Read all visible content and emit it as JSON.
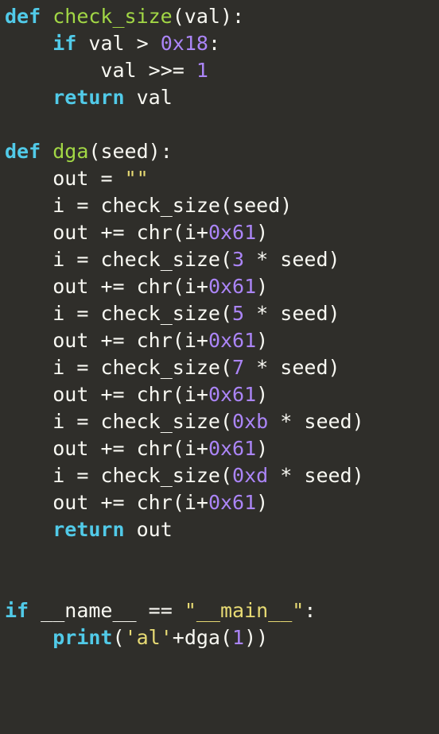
{
  "code": {
    "lines": [
      {
        "indent": 0,
        "tokens": [
          {
            "cls": "kw",
            "t": "def"
          },
          {
            "cls": "op",
            "t": " "
          },
          {
            "cls": "fn",
            "t": "check_size"
          },
          {
            "cls": "op",
            "t": "("
          },
          {
            "cls": "id",
            "t": "val"
          },
          {
            "cls": "op",
            "t": "):"
          }
        ]
      },
      {
        "indent": 1,
        "tokens": [
          {
            "cls": "kw",
            "t": "if"
          },
          {
            "cls": "op",
            "t": " "
          },
          {
            "cls": "id",
            "t": "val"
          },
          {
            "cls": "op",
            "t": " "
          },
          {
            "cls": "op",
            "t": ">"
          },
          {
            "cls": "op",
            "t": " "
          },
          {
            "cls": "num",
            "t": "0x18"
          },
          {
            "cls": "op",
            "t": ":"
          }
        ]
      },
      {
        "indent": 2,
        "tokens": [
          {
            "cls": "id",
            "t": "val"
          },
          {
            "cls": "op",
            "t": " "
          },
          {
            "cls": "op",
            "t": ">>="
          },
          {
            "cls": "op",
            "t": " "
          },
          {
            "cls": "num",
            "t": "1"
          }
        ]
      },
      {
        "indent": 1,
        "tokens": [
          {
            "cls": "kw",
            "t": "return"
          },
          {
            "cls": "op",
            "t": " "
          },
          {
            "cls": "id",
            "t": "val"
          }
        ]
      },
      {
        "indent": 0,
        "tokens": []
      },
      {
        "indent": 0,
        "tokens": [
          {
            "cls": "kw",
            "t": "def"
          },
          {
            "cls": "op",
            "t": " "
          },
          {
            "cls": "fn",
            "t": "dga"
          },
          {
            "cls": "op",
            "t": "("
          },
          {
            "cls": "id",
            "t": "seed"
          },
          {
            "cls": "op",
            "t": "):"
          }
        ]
      },
      {
        "indent": 1,
        "tokens": [
          {
            "cls": "id",
            "t": "out"
          },
          {
            "cls": "op",
            "t": " "
          },
          {
            "cls": "op",
            "t": "="
          },
          {
            "cls": "op",
            "t": " "
          },
          {
            "cls": "str",
            "t": "\"\""
          }
        ]
      },
      {
        "indent": 1,
        "tokens": [
          {
            "cls": "id",
            "t": "i"
          },
          {
            "cls": "op",
            "t": " "
          },
          {
            "cls": "op",
            "t": "="
          },
          {
            "cls": "op",
            "t": " "
          },
          {
            "cls": "id",
            "t": "check_size"
          },
          {
            "cls": "op",
            "t": "("
          },
          {
            "cls": "id",
            "t": "seed"
          },
          {
            "cls": "op",
            "t": ")"
          }
        ]
      },
      {
        "indent": 1,
        "tokens": [
          {
            "cls": "id",
            "t": "out"
          },
          {
            "cls": "op",
            "t": " "
          },
          {
            "cls": "op",
            "t": "+="
          },
          {
            "cls": "op",
            "t": " "
          },
          {
            "cls": "id",
            "t": "chr"
          },
          {
            "cls": "op",
            "t": "("
          },
          {
            "cls": "id",
            "t": "i"
          },
          {
            "cls": "op",
            "t": "+"
          },
          {
            "cls": "num",
            "t": "0x61"
          },
          {
            "cls": "op",
            "t": ")"
          }
        ]
      },
      {
        "indent": 1,
        "tokens": [
          {
            "cls": "id",
            "t": "i"
          },
          {
            "cls": "op",
            "t": " "
          },
          {
            "cls": "op",
            "t": "="
          },
          {
            "cls": "op",
            "t": " "
          },
          {
            "cls": "id",
            "t": "check_size"
          },
          {
            "cls": "op",
            "t": "("
          },
          {
            "cls": "num",
            "t": "3"
          },
          {
            "cls": "op",
            "t": " "
          },
          {
            "cls": "op",
            "t": "*"
          },
          {
            "cls": "op",
            "t": " "
          },
          {
            "cls": "id",
            "t": "seed"
          },
          {
            "cls": "op",
            "t": ")"
          }
        ]
      },
      {
        "indent": 1,
        "tokens": [
          {
            "cls": "id",
            "t": "out"
          },
          {
            "cls": "op",
            "t": " "
          },
          {
            "cls": "op",
            "t": "+="
          },
          {
            "cls": "op",
            "t": " "
          },
          {
            "cls": "id",
            "t": "chr"
          },
          {
            "cls": "op",
            "t": "("
          },
          {
            "cls": "id",
            "t": "i"
          },
          {
            "cls": "op",
            "t": "+"
          },
          {
            "cls": "num",
            "t": "0x61"
          },
          {
            "cls": "op",
            "t": ")"
          }
        ]
      },
      {
        "indent": 1,
        "tokens": [
          {
            "cls": "id",
            "t": "i"
          },
          {
            "cls": "op",
            "t": " "
          },
          {
            "cls": "op",
            "t": "="
          },
          {
            "cls": "op",
            "t": " "
          },
          {
            "cls": "id",
            "t": "check_size"
          },
          {
            "cls": "op",
            "t": "("
          },
          {
            "cls": "num",
            "t": "5"
          },
          {
            "cls": "op",
            "t": " "
          },
          {
            "cls": "op",
            "t": "*"
          },
          {
            "cls": "op",
            "t": " "
          },
          {
            "cls": "id",
            "t": "seed"
          },
          {
            "cls": "op",
            "t": ")"
          }
        ]
      },
      {
        "indent": 1,
        "tokens": [
          {
            "cls": "id",
            "t": "out"
          },
          {
            "cls": "op",
            "t": " "
          },
          {
            "cls": "op",
            "t": "+="
          },
          {
            "cls": "op",
            "t": " "
          },
          {
            "cls": "id",
            "t": "chr"
          },
          {
            "cls": "op",
            "t": "("
          },
          {
            "cls": "id",
            "t": "i"
          },
          {
            "cls": "op",
            "t": "+"
          },
          {
            "cls": "num",
            "t": "0x61"
          },
          {
            "cls": "op",
            "t": ")"
          }
        ]
      },
      {
        "indent": 1,
        "tokens": [
          {
            "cls": "id",
            "t": "i"
          },
          {
            "cls": "op",
            "t": " "
          },
          {
            "cls": "op",
            "t": "="
          },
          {
            "cls": "op",
            "t": " "
          },
          {
            "cls": "id",
            "t": "check_size"
          },
          {
            "cls": "op",
            "t": "("
          },
          {
            "cls": "num",
            "t": "7"
          },
          {
            "cls": "op",
            "t": " "
          },
          {
            "cls": "op",
            "t": "*"
          },
          {
            "cls": "op",
            "t": " "
          },
          {
            "cls": "id",
            "t": "seed"
          },
          {
            "cls": "op",
            "t": ")"
          }
        ]
      },
      {
        "indent": 1,
        "tokens": [
          {
            "cls": "id",
            "t": "out"
          },
          {
            "cls": "op",
            "t": " "
          },
          {
            "cls": "op",
            "t": "+="
          },
          {
            "cls": "op",
            "t": " "
          },
          {
            "cls": "id",
            "t": "chr"
          },
          {
            "cls": "op",
            "t": "("
          },
          {
            "cls": "id",
            "t": "i"
          },
          {
            "cls": "op",
            "t": "+"
          },
          {
            "cls": "num",
            "t": "0x61"
          },
          {
            "cls": "op",
            "t": ")"
          }
        ]
      },
      {
        "indent": 1,
        "tokens": [
          {
            "cls": "id",
            "t": "i"
          },
          {
            "cls": "op",
            "t": " "
          },
          {
            "cls": "op",
            "t": "="
          },
          {
            "cls": "op",
            "t": " "
          },
          {
            "cls": "id",
            "t": "check_size"
          },
          {
            "cls": "op",
            "t": "("
          },
          {
            "cls": "num",
            "t": "0xb"
          },
          {
            "cls": "op",
            "t": " "
          },
          {
            "cls": "op",
            "t": "*"
          },
          {
            "cls": "op",
            "t": " "
          },
          {
            "cls": "id",
            "t": "seed"
          },
          {
            "cls": "op",
            "t": ")"
          }
        ]
      },
      {
        "indent": 1,
        "tokens": [
          {
            "cls": "id",
            "t": "out"
          },
          {
            "cls": "op",
            "t": " "
          },
          {
            "cls": "op",
            "t": "+="
          },
          {
            "cls": "op",
            "t": " "
          },
          {
            "cls": "id",
            "t": "chr"
          },
          {
            "cls": "op",
            "t": "("
          },
          {
            "cls": "id",
            "t": "i"
          },
          {
            "cls": "op",
            "t": "+"
          },
          {
            "cls": "num",
            "t": "0x61"
          },
          {
            "cls": "op",
            "t": ")"
          }
        ]
      },
      {
        "indent": 1,
        "tokens": [
          {
            "cls": "id",
            "t": "i"
          },
          {
            "cls": "op",
            "t": " "
          },
          {
            "cls": "op",
            "t": "="
          },
          {
            "cls": "op",
            "t": " "
          },
          {
            "cls": "id",
            "t": "check_size"
          },
          {
            "cls": "op",
            "t": "("
          },
          {
            "cls": "num",
            "t": "0xd"
          },
          {
            "cls": "op",
            "t": " "
          },
          {
            "cls": "op",
            "t": "*"
          },
          {
            "cls": "op",
            "t": " "
          },
          {
            "cls": "id",
            "t": "seed"
          },
          {
            "cls": "op",
            "t": ")"
          }
        ]
      },
      {
        "indent": 1,
        "tokens": [
          {
            "cls": "id",
            "t": "out"
          },
          {
            "cls": "op",
            "t": " "
          },
          {
            "cls": "op",
            "t": "+="
          },
          {
            "cls": "op",
            "t": " "
          },
          {
            "cls": "id",
            "t": "chr"
          },
          {
            "cls": "op",
            "t": "("
          },
          {
            "cls": "id",
            "t": "i"
          },
          {
            "cls": "op",
            "t": "+"
          },
          {
            "cls": "num",
            "t": "0x61"
          },
          {
            "cls": "op",
            "t": ")"
          }
        ]
      },
      {
        "indent": 1,
        "tokens": [
          {
            "cls": "kw",
            "t": "return"
          },
          {
            "cls": "op",
            "t": " "
          },
          {
            "cls": "id",
            "t": "out"
          }
        ]
      },
      {
        "indent": 0,
        "tokens": []
      },
      {
        "indent": 0,
        "tokens": []
      },
      {
        "indent": 0,
        "tokens": [
          {
            "cls": "kw",
            "t": "if"
          },
          {
            "cls": "op",
            "t": " "
          },
          {
            "cls": "id",
            "t": "__name__"
          },
          {
            "cls": "op",
            "t": " "
          },
          {
            "cls": "op",
            "t": "=="
          },
          {
            "cls": "op",
            "t": " "
          },
          {
            "cls": "str",
            "t": "\"__main__\""
          },
          {
            "cls": "op",
            "t": ":"
          }
        ]
      },
      {
        "indent": 1,
        "tokens": [
          {
            "cls": "kw",
            "t": "print"
          },
          {
            "cls": "op",
            "t": "("
          },
          {
            "cls": "str",
            "t": "'al'"
          },
          {
            "cls": "op",
            "t": "+"
          },
          {
            "cls": "id",
            "t": "dga"
          },
          {
            "cls": "op",
            "t": "("
          },
          {
            "cls": "num",
            "t": "1"
          },
          {
            "cls": "op",
            "t": "))"
          }
        ]
      }
    ]
  },
  "indent_unit": "    "
}
